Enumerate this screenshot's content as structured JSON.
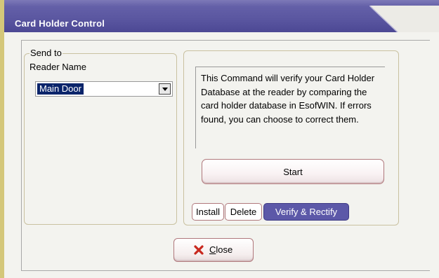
{
  "window": {
    "title": "Card Holder Control"
  },
  "send_to": {
    "group_label": "Send to",
    "reader_label": "Reader Name",
    "reader_value": "Main Door"
  },
  "command": {
    "description": "This Command will verify your Card Holder Database at the reader by comparing the card holder database in EsofWIN.  If errors found, you can choose to correct them.",
    "start_label": "Start",
    "tabs": [
      {
        "label": "Install",
        "active": false
      },
      {
        "label": "Delete",
        "active": false
      },
      {
        "label": "Verify & Rectify",
        "active": true
      }
    ]
  },
  "footer": {
    "close_label_prefix": "C",
    "close_label_rest": "lose"
  },
  "colors": {
    "title_bar": "#5a56a0",
    "active_tab": "#5c58a8",
    "close_icon": "#c8281e"
  },
  "icons": {
    "close": "x-mark-icon",
    "dropdown": "chevron-down-icon"
  }
}
